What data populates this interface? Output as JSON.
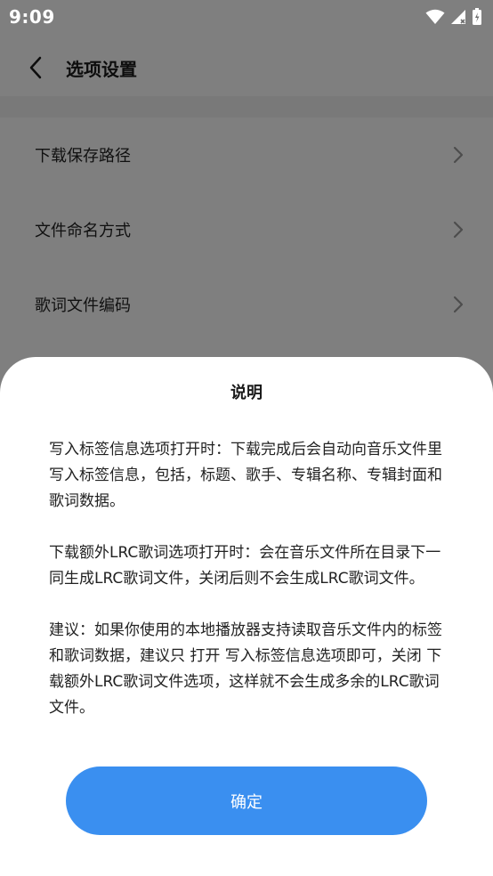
{
  "status_bar": {
    "time": "9:09",
    "icons": [
      "wifi-icon",
      "signal-icon",
      "battery-icon"
    ]
  },
  "app_bar": {
    "back_icon": "chevron-left-icon",
    "title": "选项设置"
  },
  "settings": {
    "items": [
      {
        "label": "下载保存路径",
        "icon": "chevron-right-icon"
      },
      {
        "label": "文件命名方式",
        "icon": "chevron-right-icon"
      },
      {
        "label": "歌词文件编码",
        "icon": "chevron-right-icon"
      }
    ]
  },
  "dialog": {
    "title": "说明",
    "paragraphs": [
      "写入标签信息选项打开时：下载完成后会自动向音乐文件里写入标签信息，包括，标题、歌手、专辑名称、专辑封面和歌词数据。",
      "下载额外LRC歌词选项打开时：会在音乐文件所在目录下一同生成LRC歌词文件，关闭后则不会生成LRC歌词文件。",
      "建议：如果你使用的本地播放器支持读取音乐文件内的标签和歌词数据，建议只 打开 写入标签信息选项即可，关闭 下载额外LRC歌词文件选项，这样就不会生成多余的LRC歌词文件。"
    ],
    "confirm_label": "确定"
  },
  "colors": {
    "accent": "#3a8ff0",
    "scrim": "#000000",
    "sheet_background": "#ffffff"
  }
}
